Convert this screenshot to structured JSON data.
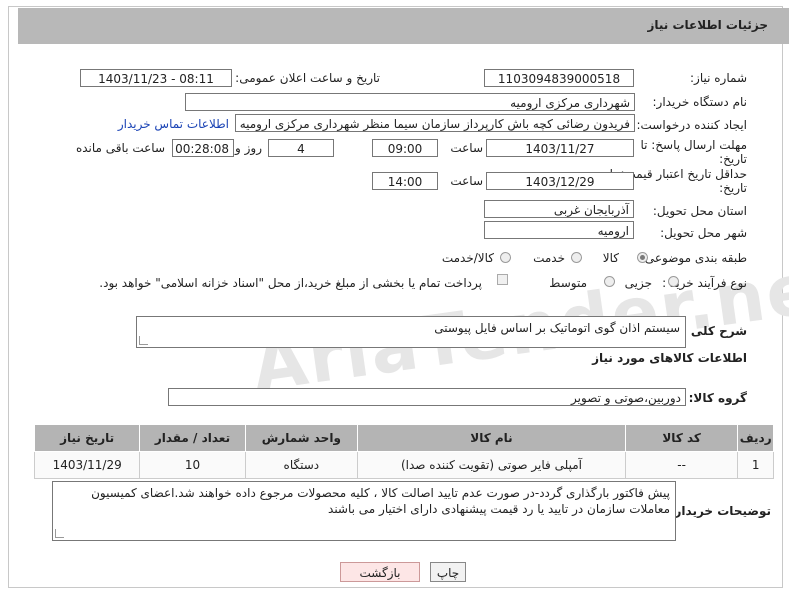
{
  "header": {
    "title": "جزئیات اطلاعات نیاز"
  },
  "fields": {
    "need_number_label": "شماره نیاز:",
    "need_number": "1103094839000518",
    "announce_label": "تاریخ و ساعت اعلان عمومی:",
    "announce_value": "1403/11/23 - 08:11",
    "buyer_label": "نام دستگاه خریدار:",
    "buyer_value": "شهرداری مرکزی ارومیه",
    "creator_label": "ایجاد کننده درخواست:",
    "creator_value": "فریدون رضائی کچه باش کارپرداز سازمان سیما منظر شهرداری مرکزی ارومیه",
    "contact_link": "اطلاعات تماس خریدار",
    "deadline_label_1": "مهلت ارسال پاسخ: تا",
    "deadline_label_2": "تاریخ:",
    "deadline_date": "1403/11/27",
    "time_label": "ساعت",
    "deadline_time": "09:00",
    "days_value": "4",
    "day_and_label": "روز و",
    "remaining_time": "00:28:08",
    "remaining_label": "ساعت باقی مانده",
    "validity_label_1": "حداقل تاریخ اعتبار قیمت: تا",
    "validity_label_2": "تاریخ:",
    "validity_date": "1403/12/29",
    "validity_time_label": "ساعت",
    "validity_time": "14:00",
    "province_label": "استان محل تحویل:",
    "province_value": "آذربایجان غربی",
    "city_label": "شهر محل تحویل:",
    "city_value": "ارومیه",
    "category_label": "طبقه بندی موضوعی:",
    "cat_goods": "کالا",
    "cat_service": "خدمت",
    "cat_both": "کالا/خدمت",
    "process_label": "نوع فرآیند خرید :",
    "proc_partial": "جزیی",
    "proc_medium": "متوسط",
    "payment_note": "پرداخت تمام یا بخشی از مبلغ خرید،از محل \"اسناد خزانه اسلامی\" خواهد بود.",
    "description_label": "شرح کلی نیاز:",
    "description_value": "سیستم اذان گوی اتوماتیک بر اساس  فایل پیوستی",
    "goods_info_title": "اطلاعات کالاهای مورد نیاز",
    "goods_group_label": "گروه کالا:",
    "goods_group_value": "دوربین،صوتی و تصویر",
    "buyer_notes_label": "توضیحات خریدار:",
    "buyer_notes_value": "پیش فاکتور بارگذاری گردد-در صورت عدم تایید اصالت کالا ، کلیه محصولات مرجوع داده خواهند شد.اعضای کمیسیون معاملات سازمان در تایید یا رد قیمت پیشنهادی دارای اختیار می باشند"
  },
  "table": {
    "headers": {
      "row": "ردیف",
      "code": "کد کالا",
      "name": "نام کالا",
      "unit": "واحد شمارش",
      "qty": "تعداد / مقدار",
      "date": "تاریخ نیاز"
    },
    "rows": [
      {
        "row": "1",
        "code": "--",
        "name": "آمپلی فایر صوتی (تقویت کننده صدا)",
        "unit": "دستگاه",
        "qty": "10",
        "date": "1403/11/29"
      }
    ]
  },
  "buttons": {
    "print": "چاپ",
    "back": "بازگشت"
  },
  "watermark": "AriaTender.neT"
}
